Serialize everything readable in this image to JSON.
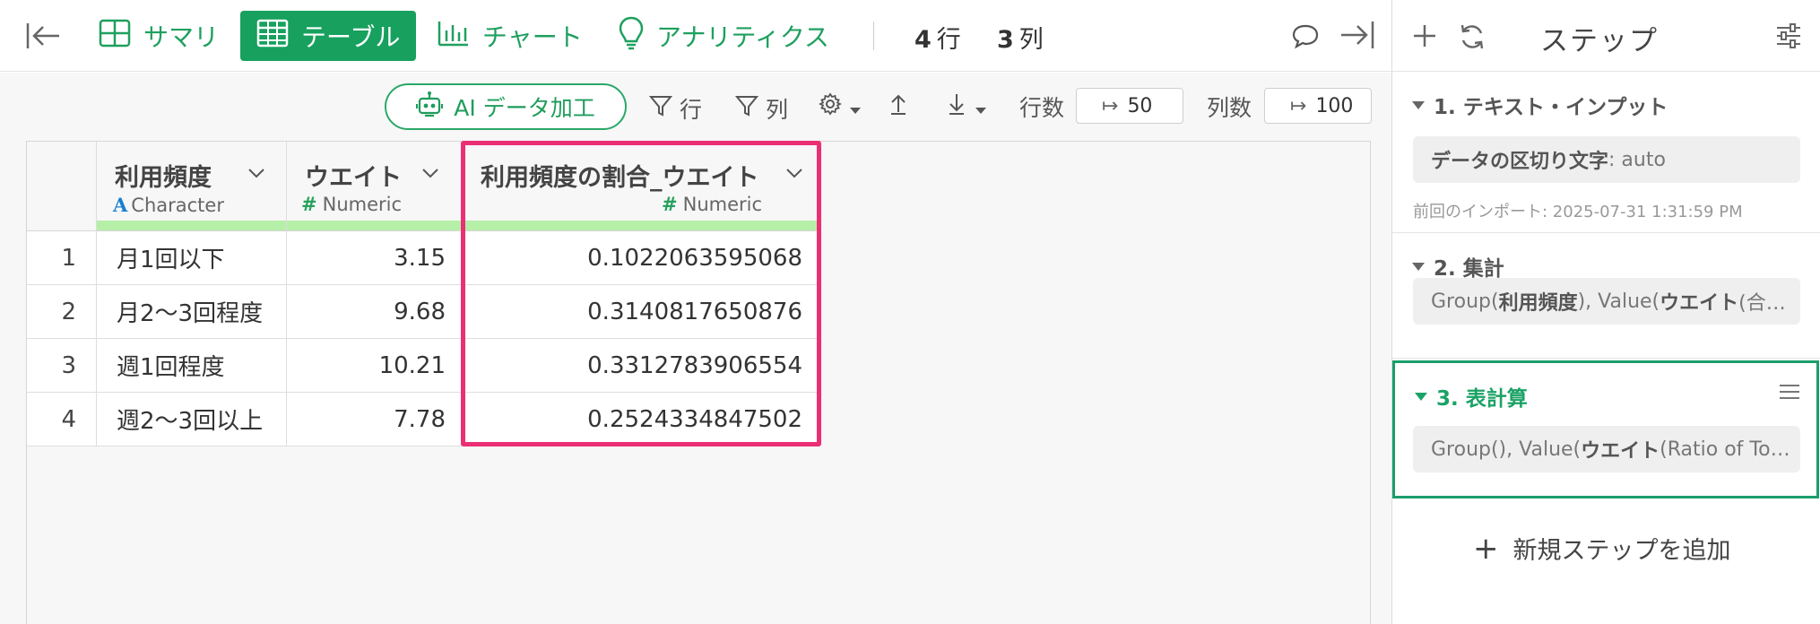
{
  "topbar": {
    "tabs": [
      {
        "label": "サマリ",
        "icon": "summary-grid-icon",
        "active": false
      },
      {
        "label": "テーブル",
        "icon": "table-icon",
        "active": true
      },
      {
        "label": "チャート",
        "icon": "chart-icon",
        "active": false
      },
      {
        "label": "アナリティクス",
        "icon": "lightbulb-icon",
        "active": false
      }
    ],
    "row_count": "4",
    "row_count_unit": "行",
    "col_count": "3",
    "col_count_unit": "列"
  },
  "toolbar": {
    "ai_button_label": "AI データ加工",
    "filter_row_label": "行",
    "filter_col_label": "列",
    "rows_label": "行数",
    "rows_value": "50",
    "cols_label": "列数",
    "cols_value": "100"
  },
  "table": {
    "columns": [
      {
        "name": "利用頻度",
        "type": "Character",
        "type_icon": "A"
      },
      {
        "name": "ウエイト",
        "type": "Numeric",
        "type_icon": "#"
      },
      {
        "name": "利用頻度の割合_ウエイト",
        "type": "Numeric",
        "type_icon": "#"
      }
    ],
    "rows": [
      {
        "index": "1",
        "c1": "月1回以下",
        "c2": "3.15",
        "c3": "0.1022063595068"
      },
      {
        "index": "2",
        "c1": "月2〜3回程度",
        "c2": "9.68",
        "c3": "0.3140817650876"
      },
      {
        "index": "3",
        "c1": "週1回程度",
        "c2": "10.21",
        "c3": "0.3312783906554"
      },
      {
        "index": "4",
        "c1": "週2〜3回以上",
        "c2": "7.78",
        "c3": "0.2524334847502"
      }
    ]
  },
  "steps_panel": {
    "title": "ステップ",
    "steps": [
      {
        "title": "1. テキスト・インプット",
        "detail_bold": "データの区切り文字",
        "detail_rest": ": auto",
        "meta": "前回のインポート: 2025-07-31 1:31:59 PM"
      },
      {
        "title": "2. 集計",
        "detail_pre": "Group(",
        "detail_bold1": "利用頻度",
        "detail_mid": "), Value(",
        "detail_bold2": "ウエイト",
        "detail_post": " (合…"
      },
      {
        "title": "3. 表計算",
        "detail_pre": "Group(), Value(",
        "detail_bold": "ウエイト",
        "detail_post": " (Ratio of To…"
      }
    ],
    "add_step_label": "新規ステップを追加"
  },
  "colors": {
    "accent": "#17a05e",
    "highlight_border": "#ec2f74",
    "type_bar": "#b6efa8",
    "selected_step_border": "#1b9e6b"
  }
}
